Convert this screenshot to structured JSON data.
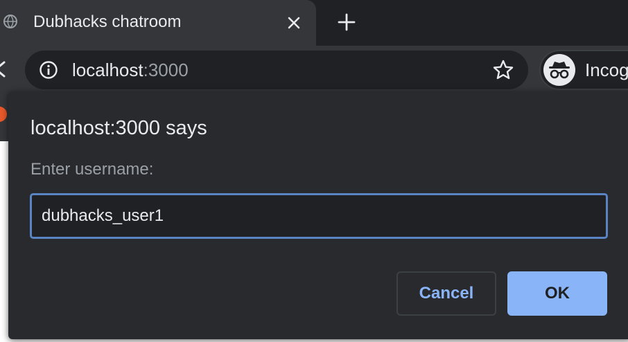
{
  "tab": {
    "title": "Dubhacks chatroom",
    "favicon": "globe-icon"
  },
  "toolbar": {
    "url_host": "localhost",
    "url_port": ":3000",
    "profile_label": "Incog"
  },
  "dialog": {
    "title": "localhost:3000 says",
    "message": "Enter username:",
    "input_value": "dubhacks_user1",
    "cancel_label": "Cancel",
    "ok_label": "OK"
  },
  "colors": {
    "accent": "#8ab4f8",
    "focus_border": "#5b84c4",
    "dialog_bg": "#292a2d",
    "toolbar_bg": "#35363a"
  }
}
